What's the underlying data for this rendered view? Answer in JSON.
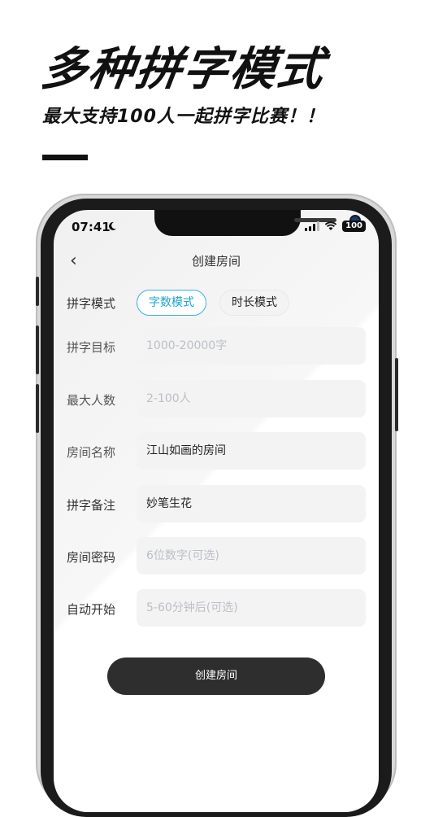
{
  "promo": {
    "title": "多种拼字模式",
    "subtitle": "最大支持100人一起拼字比赛！！"
  },
  "status_bar": {
    "time": "07:41",
    "battery": "100"
  },
  "nav": {
    "title": "创建房间"
  },
  "form": {
    "mode_label": "拼字模式",
    "modes": [
      {
        "label": "字数模式",
        "selected": true
      },
      {
        "label": "时长模式",
        "selected": false
      }
    ],
    "target": {
      "label": "拼字目标",
      "placeholder": "1000-20000字"
    },
    "max_people": {
      "label": "最大人数",
      "placeholder": "2-100人"
    },
    "room_name": {
      "label": "房间名称",
      "value": "江山如画的房间"
    },
    "note": {
      "label": "拼字备注",
      "value": "妙笔生花"
    },
    "password": {
      "label": "房间密码",
      "placeholder": "6位数字(可选)"
    },
    "auto_start": {
      "label": "自动开始",
      "placeholder": "5-60分钟后(可选)"
    }
  },
  "create_button": "创建房间",
  "colors": {
    "accent": "#1aa5cf",
    "button_bg": "#2e2e2e",
    "field_bg": "#f3f3f3"
  }
}
